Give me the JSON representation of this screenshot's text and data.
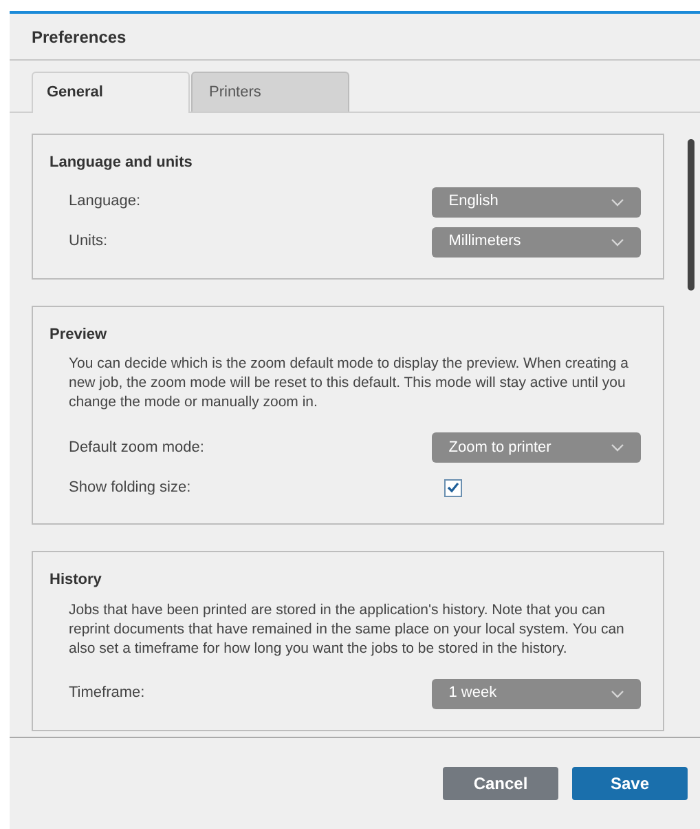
{
  "window": {
    "title": "Preferences"
  },
  "tabs": [
    {
      "label": "General",
      "selected": true
    },
    {
      "label": "Printers",
      "selected": false
    }
  ],
  "sections": [
    {
      "title": "Language and units",
      "rows": [
        {
          "kind": "select",
          "label": "Language:",
          "value": "English"
        },
        {
          "kind": "select",
          "label": "Units:",
          "value": "Millimeters"
        }
      ]
    },
    {
      "title": "Preview",
      "description": "You can decide which is the zoom default mode to display the preview. When creating a new job, the zoom mode will be reset to this default. This mode will stay active until you change the mode or manually zoom in.",
      "rows": [
        {
          "kind": "select",
          "label": "Default zoom mode:",
          "value": "Zoom to printer"
        },
        {
          "kind": "checkbox",
          "label": "Show folding size:",
          "checked": true
        }
      ]
    },
    {
      "title": "History",
      "description": "Jobs that have been printed are stored in the application's history. Note that you can reprint documents that have remained in the same place on your local system. You can also set a timeframe for how long you want the jobs to be stored in the history.",
      "rows": [
        {
          "kind": "select",
          "label": "Timeframe:",
          "value": "1 week"
        }
      ]
    }
  ],
  "buttons": [
    {
      "kind": "secondary",
      "label": "Cancel"
    },
    {
      "kind": "primary",
      "label": "Save"
    }
  ]
}
